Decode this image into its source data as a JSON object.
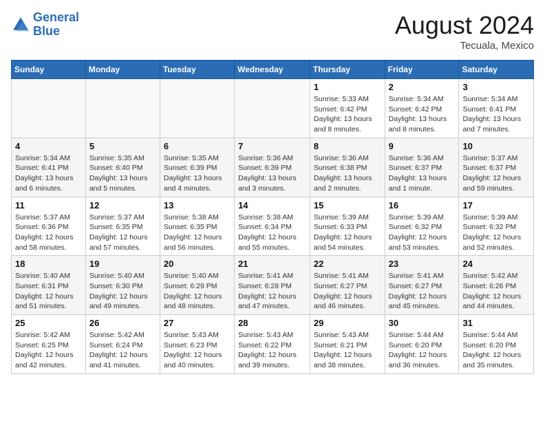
{
  "header": {
    "logo_line1": "General",
    "logo_line2": "Blue",
    "month_year": "August 2024",
    "location": "Tecuala, Mexico"
  },
  "weekdays": [
    "Sunday",
    "Monday",
    "Tuesday",
    "Wednesday",
    "Thursday",
    "Friday",
    "Saturday"
  ],
  "weeks": [
    [
      {
        "day": "",
        "detail": ""
      },
      {
        "day": "",
        "detail": ""
      },
      {
        "day": "",
        "detail": ""
      },
      {
        "day": "",
        "detail": ""
      },
      {
        "day": "1",
        "detail": "Sunrise: 5:33 AM\nSunset: 6:42 PM\nDaylight: 13 hours\nand 8 minutes."
      },
      {
        "day": "2",
        "detail": "Sunrise: 5:34 AM\nSunset: 6:42 PM\nDaylight: 13 hours\nand 8 minutes."
      },
      {
        "day": "3",
        "detail": "Sunrise: 5:34 AM\nSunset: 6:41 PM\nDaylight: 13 hours\nand 7 minutes."
      }
    ],
    [
      {
        "day": "4",
        "detail": "Sunrise: 5:34 AM\nSunset: 6:41 PM\nDaylight: 13 hours\nand 6 minutes."
      },
      {
        "day": "5",
        "detail": "Sunrise: 5:35 AM\nSunset: 6:40 PM\nDaylight: 13 hours\nand 5 minutes."
      },
      {
        "day": "6",
        "detail": "Sunrise: 5:35 AM\nSunset: 6:39 PM\nDaylight: 13 hours\nand 4 minutes."
      },
      {
        "day": "7",
        "detail": "Sunrise: 5:36 AM\nSunset: 6:39 PM\nDaylight: 13 hours\nand 3 minutes."
      },
      {
        "day": "8",
        "detail": "Sunrise: 5:36 AM\nSunset: 6:38 PM\nDaylight: 13 hours\nand 2 minutes."
      },
      {
        "day": "9",
        "detail": "Sunrise: 5:36 AM\nSunset: 6:37 PM\nDaylight: 13 hours\nand 1 minute."
      },
      {
        "day": "10",
        "detail": "Sunrise: 5:37 AM\nSunset: 6:37 PM\nDaylight: 12 hours\nand 59 minutes."
      }
    ],
    [
      {
        "day": "11",
        "detail": "Sunrise: 5:37 AM\nSunset: 6:36 PM\nDaylight: 12 hours\nand 58 minutes."
      },
      {
        "day": "12",
        "detail": "Sunrise: 5:37 AM\nSunset: 6:35 PM\nDaylight: 12 hours\nand 57 minutes."
      },
      {
        "day": "13",
        "detail": "Sunrise: 5:38 AM\nSunset: 6:35 PM\nDaylight: 12 hours\nand 56 minutes."
      },
      {
        "day": "14",
        "detail": "Sunrise: 5:38 AM\nSunset: 6:34 PM\nDaylight: 12 hours\nand 55 minutes."
      },
      {
        "day": "15",
        "detail": "Sunrise: 5:39 AM\nSunset: 6:33 PM\nDaylight: 12 hours\nand 54 minutes."
      },
      {
        "day": "16",
        "detail": "Sunrise: 5:39 AM\nSunset: 6:32 PM\nDaylight: 12 hours\nand 53 minutes."
      },
      {
        "day": "17",
        "detail": "Sunrise: 5:39 AM\nSunset: 6:32 PM\nDaylight: 12 hours\nand 52 minutes."
      }
    ],
    [
      {
        "day": "18",
        "detail": "Sunrise: 5:40 AM\nSunset: 6:31 PM\nDaylight: 12 hours\nand 51 minutes."
      },
      {
        "day": "19",
        "detail": "Sunrise: 5:40 AM\nSunset: 6:30 PM\nDaylight: 12 hours\nand 49 minutes."
      },
      {
        "day": "20",
        "detail": "Sunrise: 5:40 AM\nSunset: 6:29 PM\nDaylight: 12 hours\nand 48 minutes."
      },
      {
        "day": "21",
        "detail": "Sunrise: 5:41 AM\nSunset: 6:28 PM\nDaylight: 12 hours\nand 47 minutes."
      },
      {
        "day": "22",
        "detail": "Sunrise: 5:41 AM\nSunset: 6:27 PM\nDaylight: 12 hours\nand 46 minutes."
      },
      {
        "day": "23",
        "detail": "Sunrise: 5:41 AM\nSunset: 6:27 PM\nDaylight: 12 hours\nand 45 minutes."
      },
      {
        "day": "24",
        "detail": "Sunrise: 5:42 AM\nSunset: 6:26 PM\nDaylight: 12 hours\nand 44 minutes."
      }
    ],
    [
      {
        "day": "25",
        "detail": "Sunrise: 5:42 AM\nSunset: 6:25 PM\nDaylight: 12 hours\nand 42 minutes."
      },
      {
        "day": "26",
        "detail": "Sunrise: 5:42 AM\nSunset: 6:24 PM\nDaylight: 12 hours\nand 41 minutes."
      },
      {
        "day": "27",
        "detail": "Sunrise: 5:43 AM\nSunset: 6:23 PM\nDaylight: 12 hours\nand 40 minutes."
      },
      {
        "day": "28",
        "detail": "Sunrise: 5:43 AM\nSunset: 6:22 PM\nDaylight: 12 hours\nand 39 minutes."
      },
      {
        "day": "29",
        "detail": "Sunrise: 5:43 AM\nSunset: 6:21 PM\nDaylight: 12 hours\nand 38 minutes."
      },
      {
        "day": "30",
        "detail": "Sunrise: 5:44 AM\nSunset: 6:20 PM\nDaylight: 12 hours\nand 36 minutes."
      },
      {
        "day": "31",
        "detail": "Sunrise: 5:44 AM\nSunset: 6:20 PM\nDaylight: 12 hours\nand 35 minutes."
      }
    ]
  ]
}
